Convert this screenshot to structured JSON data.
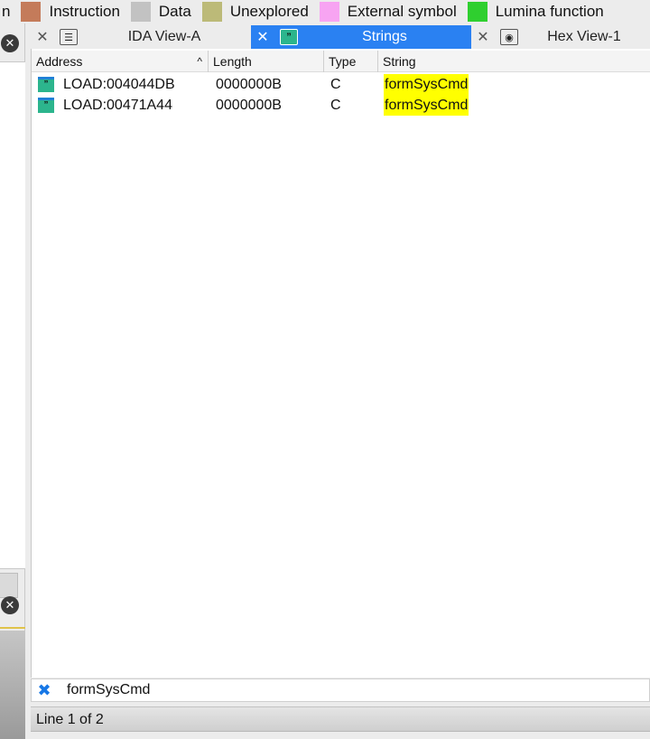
{
  "legend": [
    {
      "label": "n",
      "color": ""
    },
    {
      "label": "Instruction",
      "color": "#c47b5a"
    },
    {
      "label": "Data",
      "color": "#c2c2c2"
    },
    {
      "label": "Unexplored",
      "color": "#bcba78"
    },
    {
      "label": "External symbol",
      "color": "#f7a4f2"
    },
    {
      "label": "Lumina function",
      "color": "#2fcf2f"
    }
  ],
  "tabs": [
    {
      "label": "IDA View-A",
      "icon": "listing-icon",
      "active": false
    },
    {
      "label": "Strings",
      "icon": "quote-icon",
      "active": true
    },
    {
      "label": "Hex View-1",
      "icon": "hex-icon",
      "active": false
    }
  ],
  "table": {
    "columns": [
      "Address",
      "Length",
      "Type",
      "String"
    ],
    "sort_indicator": "^",
    "rows": [
      {
        "address": "LOAD:004044DB",
        "length": "0000000B",
        "type": "C",
        "string": "formSysCmd"
      },
      {
        "address": "LOAD:00471A44",
        "length": "0000000B",
        "type": "C",
        "string": "formSysCmd"
      }
    ]
  },
  "search": {
    "value": "formSysCmd"
  },
  "status": {
    "text": "Line 1 of 2"
  },
  "colors": {
    "active_tab": "#2a81f2",
    "highlight": "#ffff00",
    "row_icon": "#2cb58d",
    "search_close": "#1677e6"
  }
}
